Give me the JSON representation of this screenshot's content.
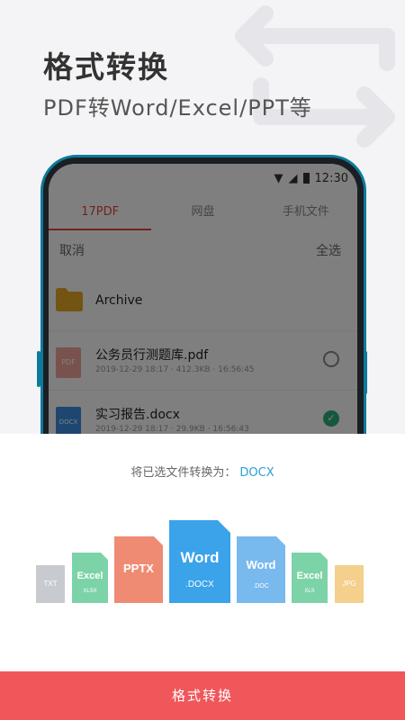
{
  "headline": "格式转换",
  "subline": "PDF转Word/Excel/PPT等",
  "status": {
    "time": "12:30"
  },
  "tabs": [
    {
      "label": "17PDF",
      "active": true
    },
    {
      "label": "网盘"
    },
    {
      "label": "手机文件"
    }
  ],
  "actions": {
    "cancel": "取消",
    "select_all": "全选"
  },
  "files": [
    {
      "name": "Archive",
      "meta": "",
      "type": "folder"
    },
    {
      "name": "公务员行测题库.pdf",
      "meta": "2019-12-29 18:17 · 412.3KB · 16:56:45",
      "type": "pdf"
    },
    {
      "name": "实习报告.docx",
      "meta": "2019-12-29 18:17 · 29.9KB · 16:56:43",
      "type": "docx"
    }
  ],
  "sheet": {
    "prompt": "将已选文件转换为：",
    "selected_format": "DOCX",
    "docs": [
      {
        "title": "",
        "ext": "TXT",
        "color": "#c7cbd0"
      },
      {
        "title": "Excel",
        "ext": "XLSX",
        "color": "#7dd3a8"
      },
      {
        "title": "PPTX",
        "ext": "",
        "color": "#f08b73"
      },
      {
        "title": "Word",
        "ext": ".DOCX",
        "color": "#3aa3ea"
      },
      {
        "title": "Word",
        "ext": ".DOC",
        "color": "#78b9ee"
      },
      {
        "title": "Excel",
        "ext": "XLS",
        "color": "#7dd3a8"
      },
      {
        "title": "",
        "ext": "JPG",
        "color": "#f4d08c"
      }
    ]
  },
  "convert_button": "格式转换",
  "file_badges": {
    "pdf": "PDF",
    "docx": "DOCX"
  }
}
